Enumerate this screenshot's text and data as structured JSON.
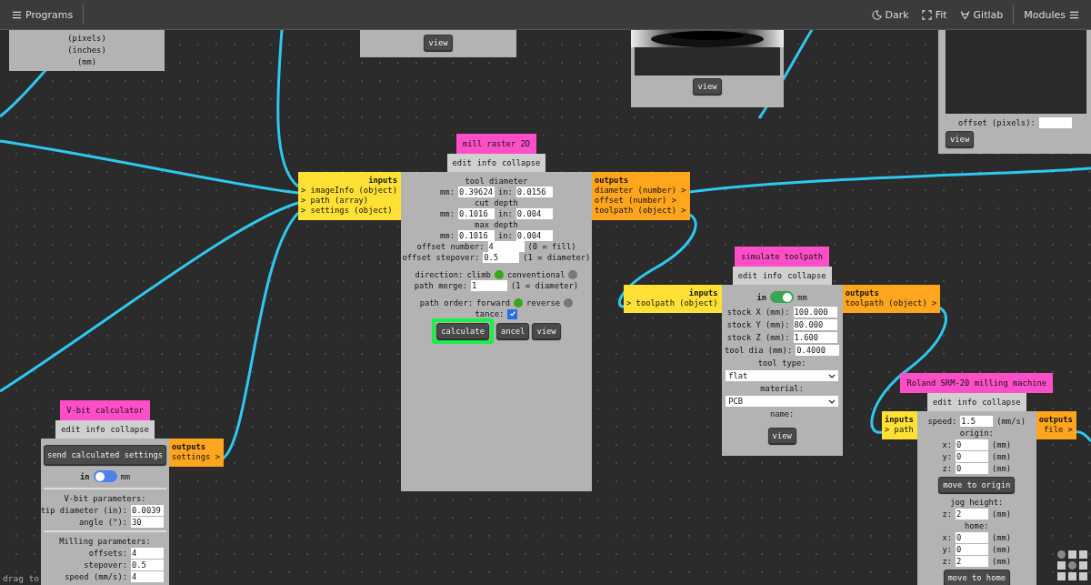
{
  "topbar": {
    "menu_label": "Programs",
    "actions": [
      {
        "kind": "theme",
        "label": "Dark"
      },
      {
        "kind": "fit",
        "label": "Fit"
      },
      {
        "kind": "repo",
        "label": "Gitlab"
      }
    ],
    "modules_label": "Modules"
  },
  "nodes": [
    {
      "rows": [
        {
          "kind": "text",
          "text": "(pixels)"
        },
        {
          "kind": "text",
          "text": "(inches)"
        },
        {
          "kind": "text",
          "text": "(mm)"
        }
      ]
    },
    {
      "rows": [
        {
          "kind": "buttons",
          "items": [
            {
              "label": "view"
            }
          ]
        }
      ]
    },
    {
      "rows": [
        {
          "kind": "picture"
        },
        {
          "kind": "buttons",
          "items": [
            {
              "label": "view"
            }
          ]
        }
      ]
    },
    {
      "rows": [
        {
          "kind": "screen"
        },
        {
          "kind": "field",
          "label": "offset (pixels):"
        },
        {
          "kind": "buttons",
          "items": [
            {
              "label": "view"
            }
          ]
        }
      ]
    },
    {
      "title": "mill raster 2D",
      "menu": [
        "edit",
        "info",
        "collapse"
      ],
      "inputs": {
        "heading": "inputs",
        "ports": [
          "> imageInfo (object)",
          "> path (array)",
          "> settings (object)"
        ]
      },
      "outputs": {
        "heading": "outputs",
        "ports": [
          "diameter (number) >",
          "offset (number) >",
          "toolpath (object) >"
        ]
      },
      "rows": [
        {
          "kind": "text",
          "text": "tool diameter"
        },
        {
          "kind": "fields",
          "items": [
            {
              "label": "mm:",
              "value": "0.39624"
            },
            {
              "label": "in:",
              "value": "0.0156"
            }
          ]
        },
        {
          "kind": "text",
          "text": "cut depth"
        },
        {
          "kind": "fields",
          "items": [
            {
              "label": "mm:",
              "value": "0.1016"
            },
            {
              "label": "in:",
              "value": "0.004"
            }
          ]
        },
        {
          "kind": "text",
          "text": "max depth"
        },
        {
          "kind": "fields",
          "items": [
            {
              "label": "mm:",
              "value": "0.1016"
            },
            {
              "label": "in:",
              "value": "0.004"
            }
          ]
        },
        {
          "kind": "field",
          "label": "offset number:",
          "value": "4",
          "suffix": "(0 = fill)"
        },
        {
          "kind": "field",
          "label": "offset stepover:",
          "value": "0.5",
          "suffix": "(1 = diameter)"
        },
        {
          "kind": "radio",
          "label": "direction:",
          "options": [
            {
              "label": "climb",
              "selected": true
            },
            {
              "label": "conventional",
              "selected": false
            }
          ]
        },
        {
          "kind": "field",
          "label": "path merge:",
          "value": "1",
          "suffix": "(1 = diameter)"
        },
        {
          "kind": "radio",
          "label": "path order:",
          "options": [
            {
              "label": "forward",
              "selected": true
            },
            {
              "label": "reverse",
              "selected": false
            }
          ]
        },
        {
          "kind": "checkbox",
          "label": "tance:",
          "checked": true
        },
        {
          "kind": "buttons",
          "items": [
            {
              "label": "calculate",
              "highlighted": true
            },
            {
              "label": "ancel"
            },
            {
              "label": "view"
            }
          ]
        }
      ]
    },
    {
      "title": "V-bit calculator",
      "menu": [
        "edit",
        "info",
        "collapse"
      ],
      "outputs": {
        "heading": "outputs",
        "ports": [
          "settings >"
        ]
      },
      "rows": [
        {
          "kind": "buttons",
          "items": [
            {
              "label": "send calculated settings"
            }
          ]
        },
        {
          "kind": "toggle",
          "left": "in",
          "right": "mm",
          "on": false
        },
        {
          "kind": "divider"
        },
        {
          "kind": "text",
          "text": "V-bit parameters:"
        },
        {
          "kind": "field",
          "label": "tip diameter (in):",
          "value": "0.0039"
        },
        {
          "kind": "field",
          "label": "angle (°):",
          "value": "30"
        },
        {
          "kind": "divider"
        },
        {
          "kind": "text",
          "text": "Milling parameters:"
        },
        {
          "kind": "field",
          "label": "offsets:",
          "value": "4"
        },
        {
          "kind": "field",
          "label": "stepover:",
          "value": "0.5"
        },
        {
          "kind": "field",
          "label": "speed (mm/s):",
          "value": "4"
        }
      ]
    },
    {
      "title": "simulate toolpath",
      "menu": [
        "edit",
        "info",
        "collapse"
      ],
      "inputs": {
        "heading": "inputs",
        "ports": [
          "> toolpath (object)"
        ]
      },
      "outputs": {
        "heading": "outputs",
        "ports": [
          "toolpath (object) >"
        ]
      },
      "rows": [
        {
          "kind": "toggle",
          "left": "in",
          "right": "mm",
          "on": true
        },
        {
          "kind": "field",
          "label": "stock X (mm):",
          "value": "100.000"
        },
        {
          "kind": "field",
          "label": "stock Y (mm):",
          "value": "80.000"
        },
        {
          "kind": "field",
          "label": "stock Z (mm):",
          "value": "1.600"
        },
        {
          "kind": "field",
          "label": "tool dia (mm):",
          "value": "0.4000"
        },
        {
          "kind": "text",
          "text": "tool type:"
        },
        {
          "kind": "select",
          "value": "flat"
        },
        {
          "kind": "text",
          "text": "material:"
        },
        {
          "kind": "select",
          "value": "PCB"
        },
        {
          "kind": "text",
          "text": "name:"
        },
        {
          "kind": "buttons",
          "items": [
            {
              "label": "view"
            }
          ]
        }
      ]
    },
    {
      "title": "Roland SRM-20 milling machine",
      "menu": [
        "edit",
        "info",
        "collapse"
      ],
      "inputs": {
        "heading": "inputs",
        "ports": [
          "> path"
        ]
      },
      "outputs": {
        "heading": "outputs",
        "ports": [
          "file >"
        ]
      },
      "rows": [
        {
          "kind": "field",
          "label": "speed:",
          "value": "1.5",
          "suffix": "(mm/s)"
        },
        {
          "kind": "text",
          "text": "origin:"
        },
        {
          "kind": "field",
          "label": "x:",
          "value": "0",
          "suffix": "(mm)"
        },
        {
          "kind": "field",
          "label": "y:",
          "value": "0",
          "suffix": "(mm)"
        },
        {
          "kind": "field",
          "label": "z:",
          "value": "0",
          "suffix": "(mm)"
        },
        {
          "kind": "buttons",
          "items": [
            {
              "label": "move to origin"
            }
          ]
        },
        {
          "kind": "text",
          "text": "jog height:"
        },
        {
          "kind": "field",
          "label": "z:",
          "value": "2",
          "suffix": "(mm)"
        },
        {
          "kind": "text",
          "text": "home:"
        },
        {
          "kind": "field",
          "label": "x:",
          "value": "0",
          "suffix": "(mm)"
        },
        {
          "kind": "field",
          "label": "y:",
          "value": "0",
          "suffix": "(mm)"
        },
        {
          "kind": "field",
          "label": "z:",
          "value": "2",
          "suffix": "(mm)"
        },
        {
          "kind": "buttons",
          "items": [
            {
              "label": "move to home"
            }
          ]
        }
      ]
    }
  ],
  "hint": "drag to"
}
